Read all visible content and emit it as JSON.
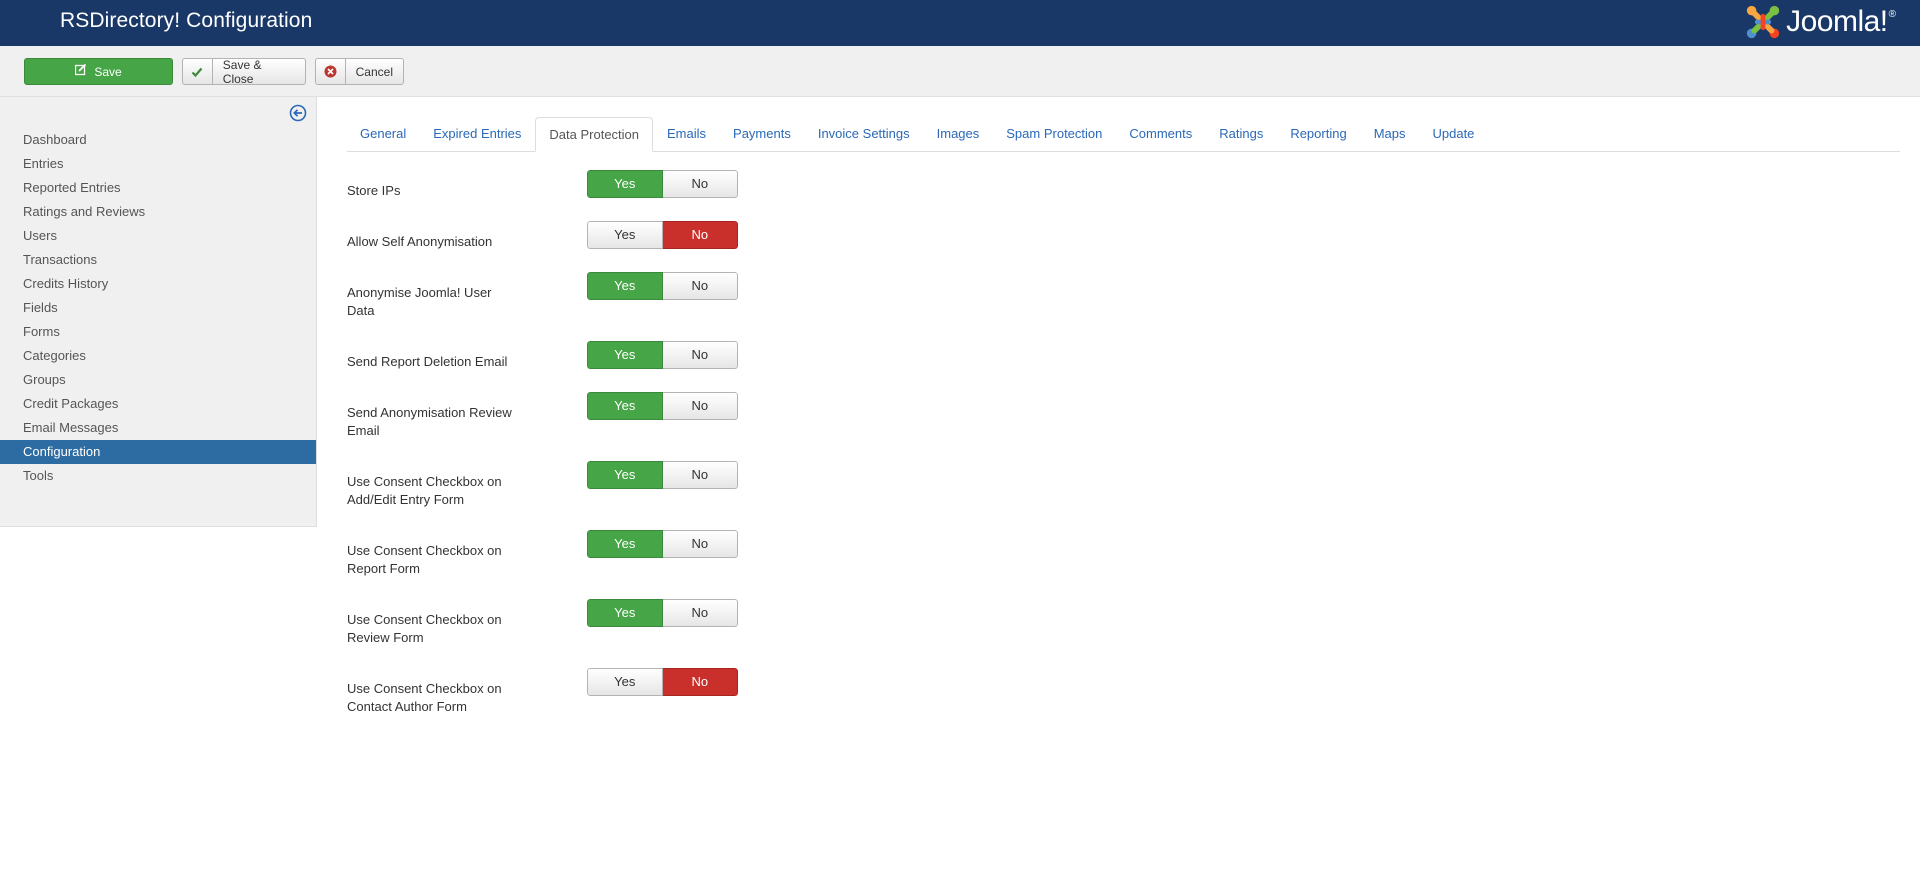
{
  "header": {
    "title": "RSDirectory! Configuration",
    "logo_text": "Joomla!",
    "logo_mark": "®"
  },
  "toolbar": {
    "save_label": "Save",
    "save_close_label": "Save & Close",
    "cancel_label": "Cancel"
  },
  "sidebar": {
    "items": [
      {
        "label": "Dashboard",
        "active": false
      },
      {
        "label": "Entries",
        "active": false
      },
      {
        "label": "Reported Entries",
        "active": false
      },
      {
        "label": "Ratings and Reviews",
        "active": false
      },
      {
        "label": "Users",
        "active": false
      },
      {
        "label": "Transactions",
        "active": false
      },
      {
        "label": "Credits History",
        "active": false
      },
      {
        "label": "Fields",
        "active": false
      },
      {
        "label": "Forms",
        "active": false
      },
      {
        "label": "Categories",
        "active": false
      },
      {
        "label": "Groups",
        "active": false
      },
      {
        "label": "Credit Packages",
        "active": false
      },
      {
        "label": "Email Messages",
        "active": false
      },
      {
        "label": "Configuration",
        "active": true
      },
      {
        "label": "Tools",
        "active": false
      }
    ]
  },
  "tabs": [
    {
      "label": "General",
      "active": false
    },
    {
      "label": "Expired Entries",
      "active": false
    },
    {
      "label": "Data Protection",
      "active": true
    },
    {
      "label": "Emails",
      "active": false
    },
    {
      "label": "Payments",
      "active": false
    },
    {
      "label": "Invoice Settings",
      "active": false
    },
    {
      "label": "Images",
      "active": false
    },
    {
      "label": "Spam Protection",
      "active": false
    },
    {
      "label": "Comments",
      "active": false
    },
    {
      "label": "Ratings",
      "active": false
    },
    {
      "label": "Reporting",
      "active": false
    },
    {
      "label": "Maps",
      "active": false
    },
    {
      "label": "Update",
      "active": false
    }
  ],
  "toggle_labels": {
    "yes": "Yes",
    "no": "No"
  },
  "settings": [
    {
      "label": "Store IPs",
      "value": "Yes"
    },
    {
      "label": "Allow Self Anonymisation",
      "value": "No"
    },
    {
      "label": "Anonymise Joomla! User Data",
      "value": "Yes"
    },
    {
      "label": "Send Report Deletion Email",
      "value": "Yes"
    },
    {
      "label": "Send Anonymisation Review Email",
      "value": "Yes"
    },
    {
      "label": "Use Consent Checkbox on Add/Edit Entry Form",
      "value": "Yes"
    },
    {
      "label": "Use Consent Checkbox on Report Form",
      "value": "Yes"
    },
    {
      "label": "Use Consent Checkbox on Review Form",
      "value": "Yes"
    },
    {
      "label": "Use Consent Checkbox on Contact Author Form",
      "value": "No"
    }
  ],
  "colors": {
    "header_bg": "#1a3867",
    "yes_active": "#46a546",
    "no_active": "#c9302c",
    "nav_active": "#2d6ca2",
    "link": "#2a69b8"
  }
}
